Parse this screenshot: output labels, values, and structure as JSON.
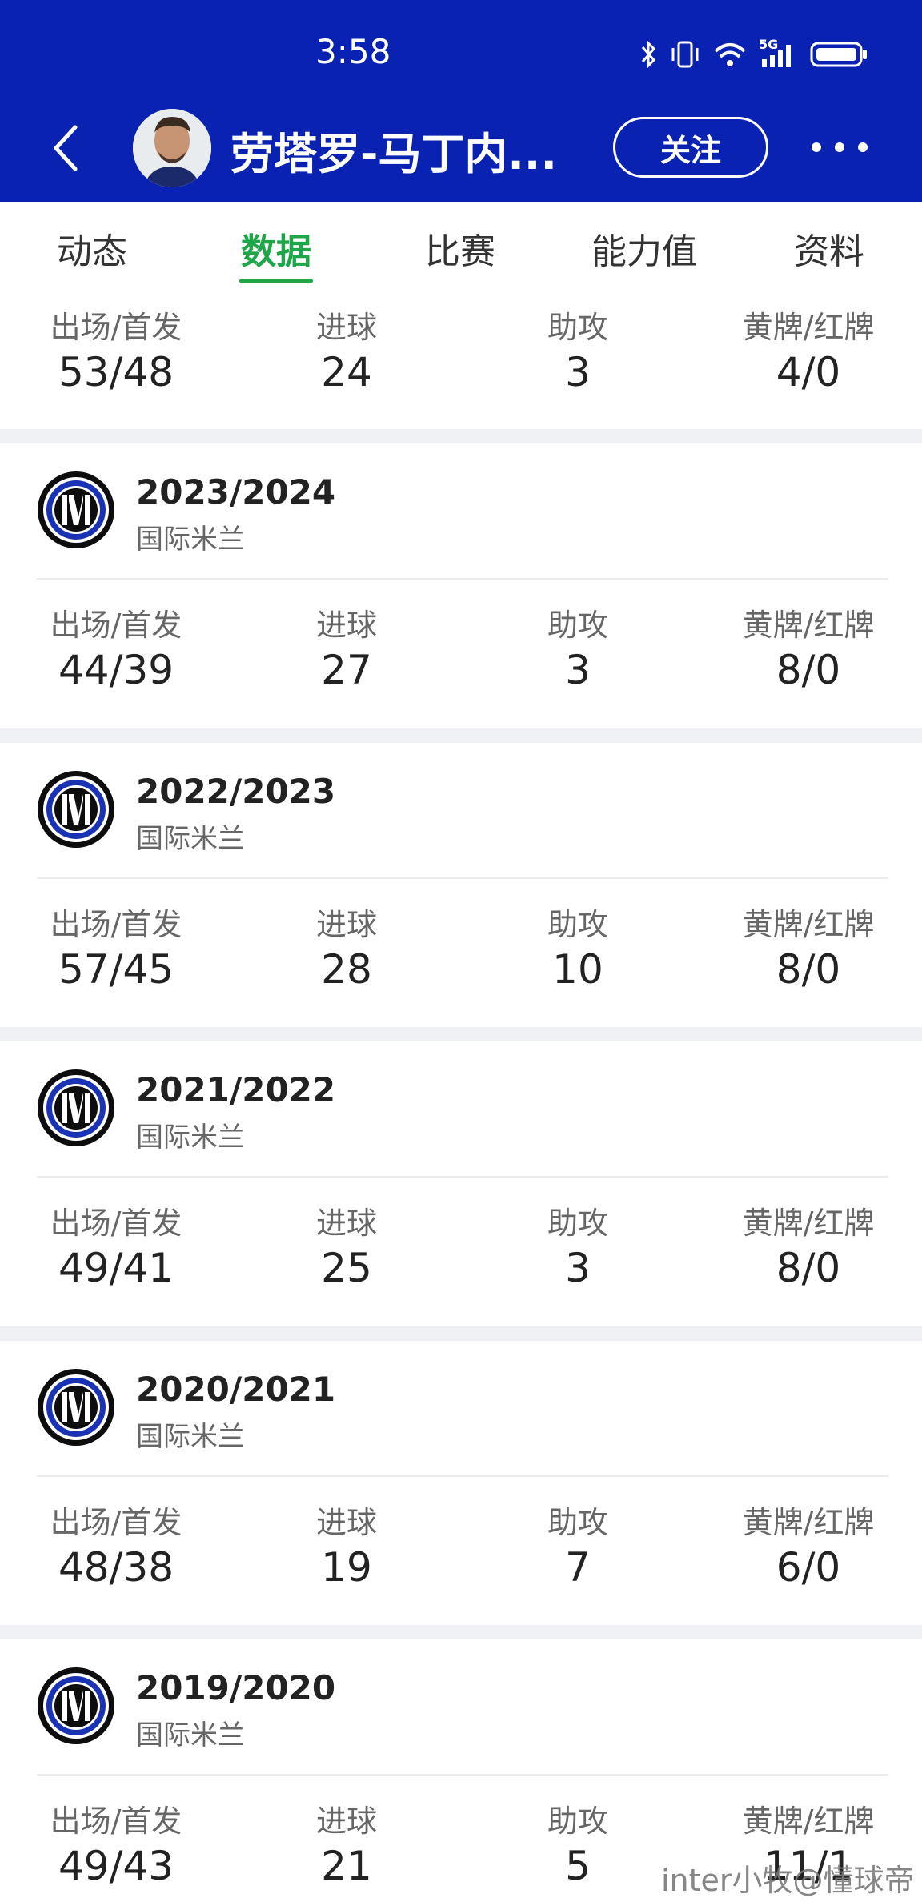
{
  "status_bar": {
    "time": "3:58",
    "icons": [
      "bluetooth-icon",
      "vibrate-icon",
      "wifi-icon",
      "signal-5g-icon",
      "battery-icon"
    ],
    "network_label": "5G"
  },
  "header": {
    "player_name": "劳塔罗-马丁内...",
    "follow_label": "关注",
    "background_color": "#0a22b2"
  },
  "tabs": [
    {
      "label": "动态",
      "active": false
    },
    {
      "label": "数据",
      "active": true
    },
    {
      "label": "比赛",
      "active": false
    },
    {
      "label": "能力值",
      "active": false
    },
    {
      "label": "资料",
      "active": false
    }
  ],
  "accent_color": "#1fa649",
  "stat_labels": {
    "apps": "出场/首发",
    "goals": "进球",
    "assists": "助攻",
    "cards": "黄牌/红牌"
  },
  "summary": {
    "apps": "53/48",
    "goals": "24",
    "assists": "3",
    "cards": "4/0"
  },
  "seasons": [
    {
      "season": "2023/2024",
      "club": "国际米兰",
      "apps": "44/39",
      "goals": "27",
      "assists": "3",
      "cards": "8/0"
    },
    {
      "season": "2022/2023",
      "club": "国际米兰",
      "apps": "57/45",
      "goals": "28",
      "assists": "10",
      "cards": "8/0"
    },
    {
      "season": "2021/2022",
      "club": "国际米兰",
      "apps": "49/41",
      "goals": "25",
      "assists": "3",
      "cards": "8/0"
    },
    {
      "season": "2020/2021",
      "club": "国际米兰",
      "apps": "48/38",
      "goals": "19",
      "assists": "7",
      "cards": "6/0"
    },
    {
      "season": "2019/2020",
      "club": "国际米兰",
      "apps": "49/43",
      "goals": "21",
      "assists": "5",
      "cards": "11/1"
    }
  ],
  "watermark": "inter小牧@懂球帝"
}
